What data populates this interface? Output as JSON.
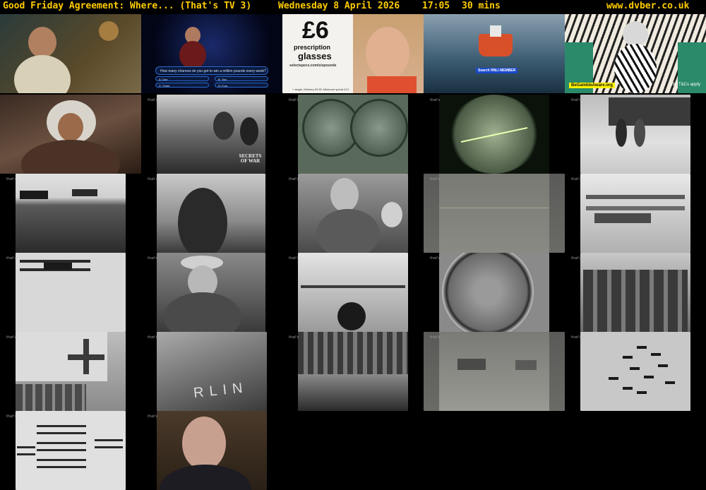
{
  "header": {
    "title": "Good Friday Agreement: Where... (That's TV 3)",
    "date": "Wednesday 8 April 2026",
    "time": "17:05",
    "duration": "30 mins",
    "site": "www.dvber.co.uk",
    "text_color": "#ffcc00"
  },
  "thumbnails": [
    {
      "name": "thumb-man-bar"
    },
    {
      "name": "thumb-quiz-show",
      "question": "How many chances do you get to win a million pounds every week?",
      "options": [
        "A: One",
        "B: Two",
        "C: Three",
        "D: Four"
      ]
    },
    {
      "name": "thumb-selectspecs-ad",
      "price": "£6",
      "line1": "prescription",
      "line2": "glasses",
      "url": "selectspecs.com/sixpounds",
      "fine_print": "+ single, Delivery £5.95. Minimum spend £12"
    },
    {
      "name": "thumb-rnli-ad",
      "button": "Search RNLI MEMBER"
    },
    {
      "name": "thumb-bingo-ad",
      "badge": "BeGambleAware.org",
      "terms": "18+ T&Cs apply"
    },
    {
      "name": "thumb-boy-hood"
    },
    {
      "name": "thumb-soldiers-grass",
      "logo": "SECRETS OF WAR"
    },
    {
      "name": "thumb-porthole-soldiers"
    },
    {
      "name": "thumb-gun-sight"
    },
    {
      "name": "thumb-train-soldiers"
    },
    {
      "name": "thumb-tanks-field"
    },
    {
      "name": "thumb-soldier-back"
    },
    {
      "name": "thumb-officials"
    },
    {
      "name": "thumb-green-lines"
    },
    {
      "name": "thumb-biplanes-field"
    },
    {
      "name": "thumb-plane-flying"
    },
    {
      "name": "thumb-man-hat-fur"
    },
    {
      "name": "thumb-cockpit-view"
    },
    {
      "name": "thumb-wheel-closeup"
    },
    {
      "name": "thumb-group-officers"
    },
    {
      "name": "thumb-plane-cross"
    },
    {
      "name": "thumb-berlin-sign",
      "sign": "RLIN"
    },
    {
      "name": "thumb-street-rubble"
    },
    {
      "name": "thumb-tanks-fog"
    },
    {
      "name": "thumb-plane-formation"
    },
    {
      "name": "thumb-biplane-formation"
    },
    {
      "name": "thumb-interviewee"
    }
  ],
  "channel_logo": "that's"
}
